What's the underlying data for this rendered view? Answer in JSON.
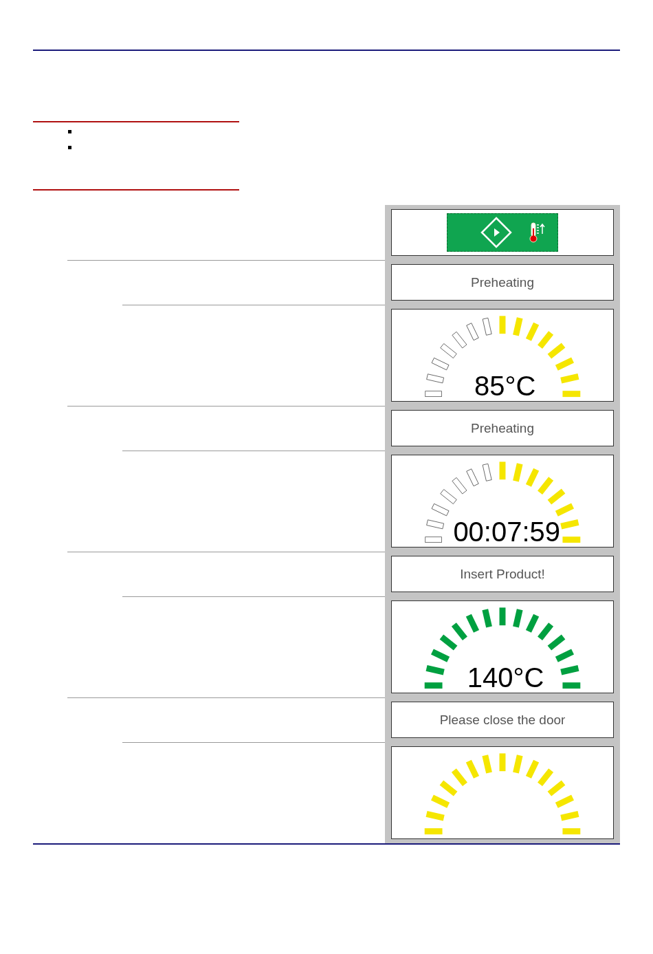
{
  "panels": [
    {
      "kind": "start_button"
    },
    {
      "kind": "message",
      "text": "Preheating"
    },
    {
      "kind": "gauge",
      "complete": false,
      "color": "#f5e600",
      "reading": "85°C"
    },
    {
      "kind": "message",
      "text": "Preheating"
    },
    {
      "kind": "gauge",
      "complete": false,
      "color": "#f5e600",
      "reading": "00:07:59"
    },
    {
      "kind": "message",
      "text": "Insert Product!"
    },
    {
      "kind": "gauge",
      "complete": true,
      "color": "#00a040",
      "reading": "140°C"
    },
    {
      "kind": "message",
      "text": "Please close the door"
    },
    {
      "kind": "gauge",
      "complete": true,
      "color": "#f5e600"
    }
  ]
}
